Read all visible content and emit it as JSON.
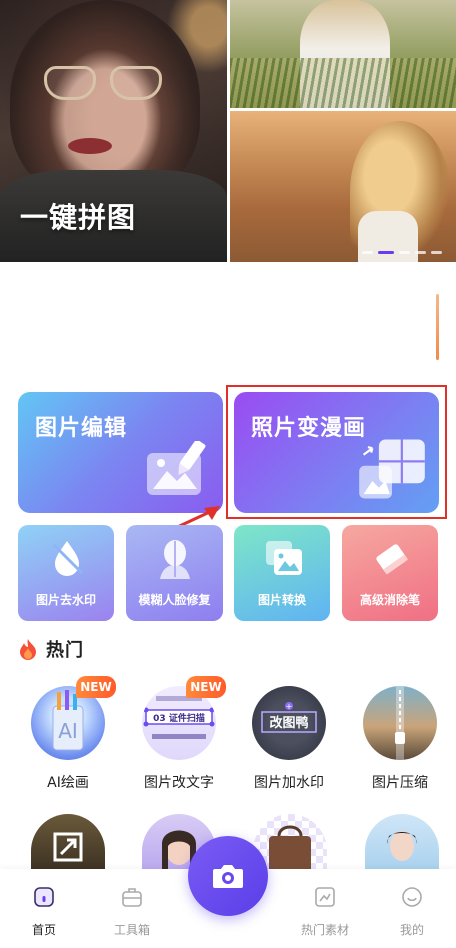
{
  "banner": {
    "title": "一键拼图",
    "slide_count": 5,
    "active_slide": 2
  },
  "features": {
    "photo_edit": "图片编辑",
    "photo_to_cartoon": "照片变漫画"
  },
  "tools": [
    {
      "label": "图片去水印",
      "icon": "watermark-remove-icon"
    },
    {
      "label": "模糊人脸修复",
      "icon": "face-restore-icon"
    },
    {
      "label": "图片转换",
      "icon": "image-convert-icon"
    },
    {
      "label": "高级消除笔",
      "icon": "eraser-icon"
    }
  ],
  "hot": {
    "title": "热门",
    "icon": "flame-icon",
    "items": [
      {
        "label": "AI绘画",
        "badge": "NEW",
        "art_text": "AI"
      },
      {
        "label": "图片改文字",
        "badge": "NEW",
        "art_text": "03 证件扫描"
      },
      {
        "label": "图片加水印",
        "badge": "",
        "art_text": "改图鸭"
      },
      {
        "label": "图片压缩",
        "badge": "",
        "art_text": ""
      }
    ]
  },
  "tabbar": {
    "tabs": [
      {
        "label": "首页",
        "icon": "home-icon",
        "active": true
      },
      {
        "label": "工具箱",
        "icon": "toolbox-icon",
        "active": false
      },
      {
        "label": "热门素材",
        "icon": "hot-material-icon",
        "active": false
      },
      {
        "label": "我的",
        "icon": "profile-icon",
        "active": false
      }
    ],
    "center_icon": "camera-icon"
  },
  "colors": {
    "accent": "#6a3cf0",
    "highlight_border": "#e0302a",
    "badge": "#ff6a2e"
  }
}
